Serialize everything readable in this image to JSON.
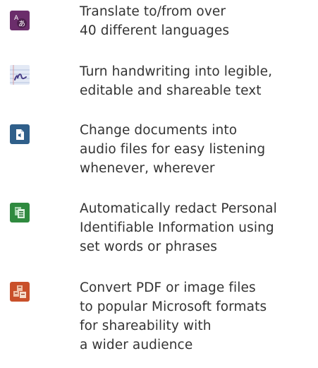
{
  "features": [
    {
      "icon": "translate-icon",
      "icon_color": "#6b2d6b",
      "lines": [
        "Translate to/from over",
        "40 different languages"
      ]
    },
    {
      "icon": "handwriting-icon",
      "icon_color": "#dfe6f3",
      "lines": [
        "Turn handwriting into legible,",
        "editable and shareable text"
      ]
    },
    {
      "icon": "document-audio-icon",
      "icon_color": "#2f5f8a",
      "lines": [
        "Change documents into",
        "audio files for easy listening",
        "whenever, wherever"
      ]
    },
    {
      "icon": "redact-document-icon",
      "icon_color": "#2f8a3f",
      "lines": [
        "Automatically redact Personal",
        "Identifiable Information using",
        "set words or phrases"
      ]
    },
    {
      "icon": "convert-office-icon",
      "icon_color": "#c9502a",
      "lines": [
        "Convert PDF or image files",
        "to popular Microsoft formats",
        "for shareability with",
        "a wider audience"
      ]
    }
  ]
}
